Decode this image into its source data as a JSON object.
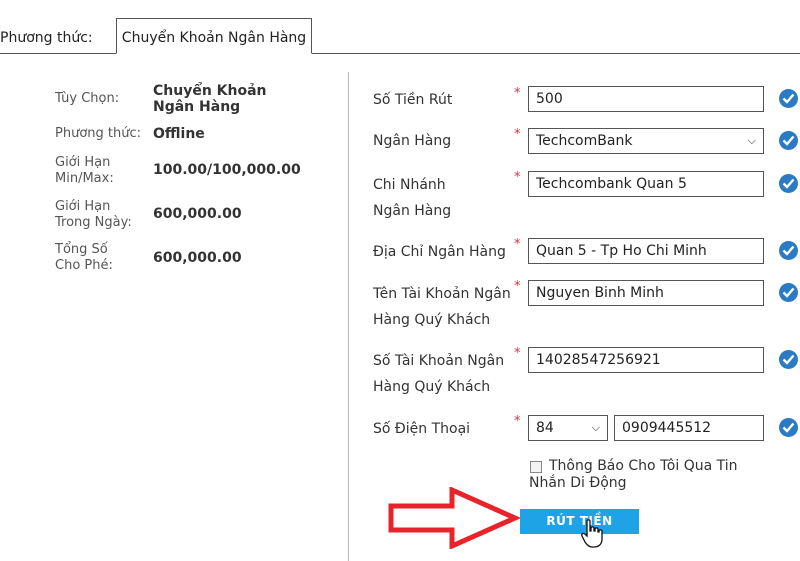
{
  "tabs": {
    "prefix_label": "Phương thức:",
    "active_tab": "Chuyển Khoản Ngân Hàng"
  },
  "info": [
    {
      "label": "Tùy Chọn:",
      "value": "Chuyển Khoản Ngân Hàng"
    },
    {
      "label": "Phương thức:",
      "value": "Offline"
    },
    {
      "label": "Giới Hạn Min/Max:",
      "value": "100.00/100,000.00"
    },
    {
      "label": "Giới Hạn Trong Ngày:",
      "value": "600,000.00"
    },
    {
      "label": "Tổng Số Cho Phé:",
      "value": "600,000.00"
    }
  ],
  "form": {
    "amount": {
      "label": "Số Tiền Rút",
      "value": "500"
    },
    "bank": {
      "label": "Ngân Hàng",
      "value": "TechcomBank"
    },
    "branch": {
      "label": "Chi Nhánh Ngân Hàng",
      "value": "Techcombank Quan 5"
    },
    "address": {
      "label": "Địa Chỉ Ngân Hàng",
      "value": "Quan 5 - Tp Ho Chi Minh"
    },
    "account_name": {
      "label": "Tên Tài Khoản Ngân Hàng Quý Khách",
      "value": "Nguyen Binh Minh"
    },
    "account_number": {
      "label": "Số Tài Khoản Ngân Hàng Quý Khách",
      "value": "14028547256921"
    },
    "phone": {
      "label": "Số Điện Thoại",
      "country_code": "84",
      "value": "0909445512"
    },
    "required_mark": "*",
    "sms_notify_label": "Thông Báo Cho Tôi Qua Tin Nhắn Di Động",
    "sms_notify_checked": false,
    "submit_label": "RÚT TIỀN"
  },
  "colors": {
    "accent": "#1ea3e6",
    "check": "#2b7bc4",
    "required": "#e0303a",
    "arrow": "#e8232a"
  }
}
